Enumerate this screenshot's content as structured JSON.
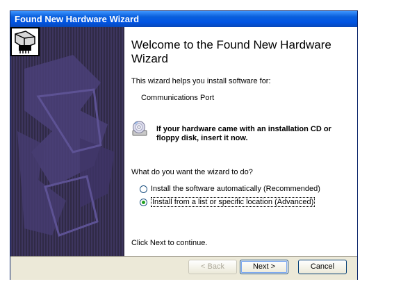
{
  "window": {
    "title": "Found New Hardware Wizard"
  },
  "content": {
    "heading": "Welcome to the Found New Hardware Wizard",
    "helps_text": "This wizard helps you install software for:",
    "device_name": "Communications Port",
    "cd_prompt": "If your hardware came with an installation CD or floppy disk, insert it now.",
    "question": "What do you want the wizard to do?",
    "options": [
      {
        "label": "Install the software automatically (Recommended)",
        "selected": false
      },
      {
        "label": "Install from a list or specific location (Advanced)",
        "selected": true
      }
    ],
    "continue_text": "Click Next to continue."
  },
  "buttons": {
    "back": "< Back",
    "next": "Next >",
    "cancel": "Cancel"
  },
  "icons": {
    "hardware": "hardware-chip-icon",
    "cd": "cd-disc-icon"
  },
  "colors": {
    "titlebar": "#0054e3",
    "sidebar": "#2f2a45",
    "footer": "#ece9d8"
  }
}
